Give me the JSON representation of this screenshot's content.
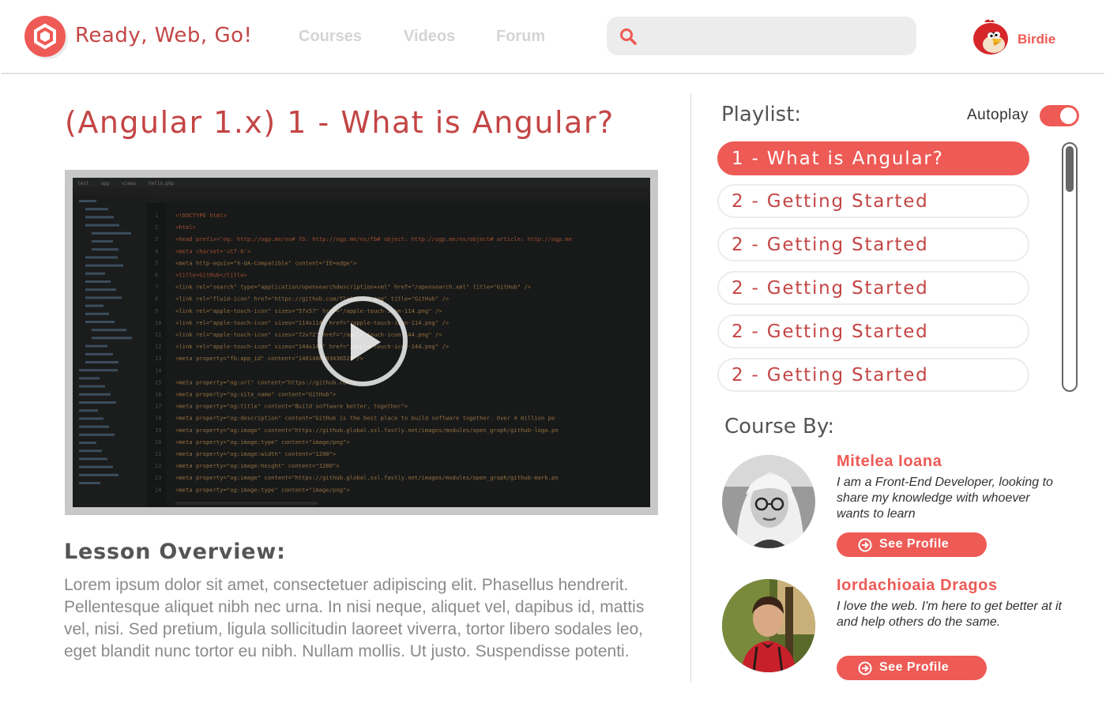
{
  "header": {
    "brand": "Ready, Web, Go!",
    "nav": [
      "Courses",
      "Videos",
      "Forum"
    ],
    "search": {
      "placeholder": "",
      "value": ""
    },
    "user": {
      "name": "Birdie"
    }
  },
  "lesson": {
    "title": "(Angular 1.x) 1 - What is Angular?",
    "overview_heading": "Lesson Overview:",
    "overview_text": "Lorem ipsum dolor sit amet, consectetuer adipiscing elit. Phasellus hendrerit. Pellentesque aliquet nibh nec urna. In nisi neque, aliquet vel, dapibus id, mattis vel, nisi. Sed pretium, ligula sollicitudin laoreet viverra, tortor libero sodales leo, eget blandit nunc tortor eu nibh. Nullam mollis. Ut justo. Suspendisse potenti."
  },
  "video": {
    "editor_tabs": [
      "test",
      "app",
      "views",
      "hello.php"
    ],
    "code_lines": [
      "<!DOCTYPE html>",
      "<html>",
      "<head prefix=\"og: http://ogp.me/ns# fb: http://ogp.me/ns/fb# object: http://ogp.me/ns/object# article: http://ogp.me",
      "    <meta charset='utf-8'>",
      "    <meta http-equiv=\"X-UA-Compatible\" content=\"IE=edge\">",
      "    <title>GitHub</title>",
      "    <link rel=\"search\" type=\"application/opensearchdescription+xml\" href=\"/opensearch.xml\" title=\"GitHub\" />",
      "    <link rel=\"fluid-icon\" href=\"https://github.com/fluidicon.png\" title=\"GitHub\" />",
      "    <link rel=\"apple-touch-icon\" sizes=\"57x57\" href=\"/apple-touch-icon-114.png\" />",
      "    <link rel=\"apple-touch-icon\" sizes=\"114x114\" href=\"/apple-touch-icon-114.png\" />",
      "    <link rel=\"apple-touch-icon\" sizes=\"72x72\" href=\"/apple-touch-icon-144.png\" />",
      "    <link rel=\"apple-touch-icon\" sizes=\"144x144\" href=\"/apple-touch-icon-144.png\" />",
      "    <meta property=\"fb:app_id\" content=\"1401488693436528\"/>",
      "",
      "    <meta property=\"og:url\" content=\"https://github.com\">",
      "    <meta property=\"og:site_name\" content=\"GitHub\">",
      "    <meta property=\"og:title\" content=\"Build software better, together\">",
      "    <meta property=\"og:description\" content=\"GitHub is the best place to build software together. Over 4 million pe",
      "    <meta property=\"og:image\" content=\"https://github.global.ssl.fastly.net/images/modules/open_graph/github-logo.pn",
      "    <meta property=\"og:image:type\" content=\"image/png\">",
      "    <meta property=\"og:image:width\" content=\"1200\">",
      "    <meta property=\"og:image:height\" content=\"1200\">",
      "    <meta property=\"og:image\" content=\"https://github.global.ssl.fastly.net/images/modules/open_graph/github-mark.pn",
      "    <meta property=\"og:image:type\" content=\"image/png\">"
    ]
  },
  "playlist": {
    "heading": "Playlist:",
    "autoplay_label": "Autoplay",
    "autoplay_on": true,
    "items": [
      {
        "label": "1 - What is Angular?",
        "active": true
      },
      {
        "label": "2 - Getting Started",
        "active": false
      },
      {
        "label": "2 - Getting Started",
        "active": false
      },
      {
        "label": "2 - Getting Started",
        "active": false
      },
      {
        "label": "2 - Getting Started",
        "active": false
      },
      {
        "label": "2 - Getting Started",
        "active": false
      }
    ]
  },
  "course_by": {
    "heading": "Course By:",
    "authors": [
      {
        "name": "Mitelea Ioana",
        "bio": "I am a Front-End Developer, looking to share my knowledge with whoever wants to learn",
        "button": "See Profile"
      },
      {
        "name": "Iordachioaia Dragos",
        "bio": "I love the web. I'm here to get better at it and help others do the same.",
        "button": "See Profile"
      }
    ]
  },
  "colors": {
    "accent": "#ee5a55",
    "title_red": "#c44545",
    "nav_gray": "#d4d4d4"
  }
}
